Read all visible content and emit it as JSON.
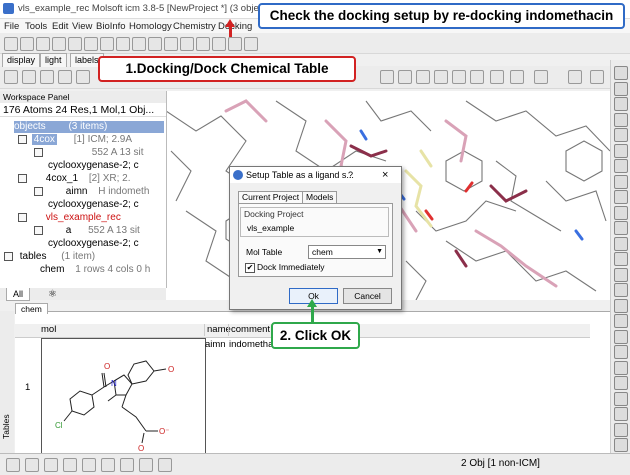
{
  "window": {
    "title": "vls_example_rec Molsoft icm 3.8-5  [NewProject *] (3 objects 1 table)"
  },
  "menubar": {
    "items": [
      "File",
      "Tools",
      "Edit",
      "View",
      "BioInfo",
      "Homology",
      "Chemistry",
      "Docking"
    ]
  },
  "callouts": {
    "top": "Check the docking setup by re-docking indomethacin",
    "step1": "1.Docking/Dock Chemical Table",
    "step2": "2. Click OK"
  },
  "left_tabs": [
    "display",
    "light",
    "labels"
  ],
  "workspace": {
    "panel_title": "Workspace Panel",
    "header": "176 Atoms 24 Res,1 Mol,1 Obj...",
    "rows": [
      {
        "text": "objects",
        "extra": "(3 items)"
      },
      {
        "text": "4cox",
        "extra": "[1] ICM; 2.9A"
      },
      {
        "text": "",
        "extra": "552 A 13 sit"
      },
      {
        "text": "cyclooxygenase-2; c",
        "extra": ""
      },
      {
        "text": "4cox_1",
        "extra": "[2] XR; 2."
      },
      {
        "text": "aimn",
        "extra": "H indometh"
      },
      {
        "text": "cyclooxygenase-2; c",
        "extra": ""
      },
      {
        "text": "vls_example_rec",
        "extra": ""
      },
      {
        "text": "a",
        "extra": "552 A 13 sit"
      },
      {
        "text": "cyclooxygenase-2; c",
        "extra": ""
      },
      {
        "text": "tables",
        "extra": "(1 item)"
      },
      {
        "text": "chem",
        "extra": "1 rows 4 cols 0 h"
      }
    ],
    "bottom_tabs": [
      "All"
    ]
  },
  "dialog": {
    "title": "Setup Table as a ligand s...",
    "help": "?",
    "close": "×",
    "tabs": [
      "Current Project",
      "Models"
    ],
    "group_label": "Docking Project",
    "project_value": "vls_example",
    "moltable_label": "Mol Table",
    "moltable_value": "chem",
    "checkbox_label": "Dock Immediately",
    "checked": true,
    "ok": "Ok",
    "cancel": "Cancel"
  },
  "table": {
    "tab_label": "chem",
    "columns": [
      "mol",
      "name",
      "comment"
    ],
    "row_number": "1",
    "row_name": "aimn",
    "row_comment": "indomethac",
    "mol_label_o": "O",
    "mol_label_n": "N",
    "mol_label_cl": "Cl",
    "mol_label_o2": "O",
    "mol_label_om": "O⁻",
    "mol_label_o3": "O"
  },
  "side_label": "Tables",
  "status": {
    "text": "2  Obj [1 non-ICM]"
  },
  "colors": {
    "callout_blue": "#2f6ac6",
    "callout_red": "#d22222",
    "callout_green": "#2fa84b",
    "selection": "#8aa7d6"
  }
}
